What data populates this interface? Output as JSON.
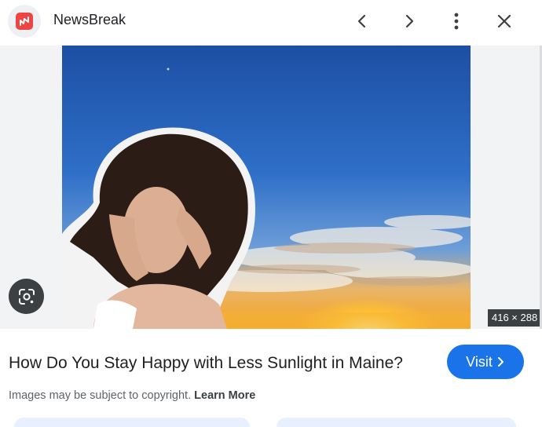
{
  "header": {
    "brand": "NewsBreak",
    "logo_icon": "newsbreak-logo-icon",
    "logo_color": "#ef4444",
    "actions": [
      "previous-icon",
      "next-icon",
      "more-vert-icon",
      "close-icon"
    ]
  },
  "image": {
    "dimensions": "416 × 288",
    "lens_icon": "google-lens-icon"
  },
  "result": {
    "title": "How Do You Stay Happy with Less Sunlight in Maine?",
    "visit_label": "Visit",
    "copyright_text": "Images may be subject to copyright.",
    "learn_more": "Learn More"
  },
  "colors": {
    "accent": "#1a73e8",
    "background": "#f1f3f4"
  }
}
